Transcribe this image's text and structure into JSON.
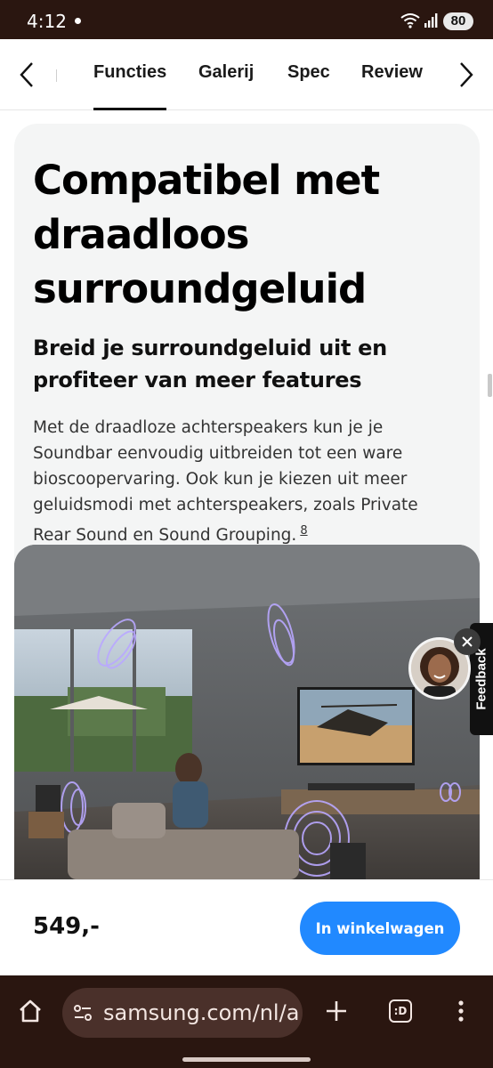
{
  "status_bar": {
    "time": "4:12",
    "battery": "80"
  },
  "tab_nav": {
    "tabs": [
      {
        "label": "Functies",
        "active": true
      },
      {
        "label": "Galerij",
        "active": false
      },
      {
        "label": "Spec",
        "active": false
      },
      {
        "label": "Review",
        "active": false
      }
    ]
  },
  "content": {
    "headline": "Compatibel met draadloos surroundgeluid",
    "subheadline": "Breid je surroundgeluid uit en profiteer van meer features",
    "body": "Met de draadloze achterspeakers kun je je Soundbar eenvoudig uitbreiden tot een ware bioscoopervaring. Ook kun je kiezen uit meer geluidsmodi met achterspeakers, zoals Private Rear Sound en Sound Grouping.",
    "footnote": "8"
  },
  "feedback": {
    "label": "Feedback"
  },
  "purchase": {
    "price": "549,-",
    "cart_button": "In winkelwagen"
  },
  "browser": {
    "url": "samsung.com/nl/a",
    "tabs_label": ":D"
  },
  "colors": {
    "accent": "#2189ff",
    "system_bar": "#2a1610",
    "card_bg": "#f4f5f5"
  }
}
